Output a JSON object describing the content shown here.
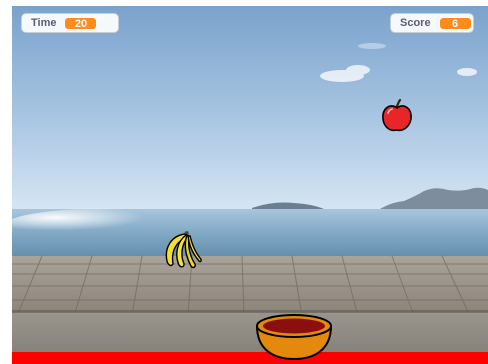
{
  "monitors": {
    "time": {
      "label": "Time",
      "value": "20"
    },
    "score": {
      "label": "Score",
      "value": "6"
    }
  },
  "sprites": {
    "apple": {
      "icon": "apple-icon"
    },
    "banana": {
      "icon": "banana-icon"
    },
    "bowl": {
      "icon": "bowl-icon"
    }
  },
  "colors": {
    "monitor_value": "#ff8c1a",
    "floor_bar": "#ff0000",
    "apple": "#e8262a",
    "banana": "#f5df2e",
    "bowl": "#e2890e"
  }
}
